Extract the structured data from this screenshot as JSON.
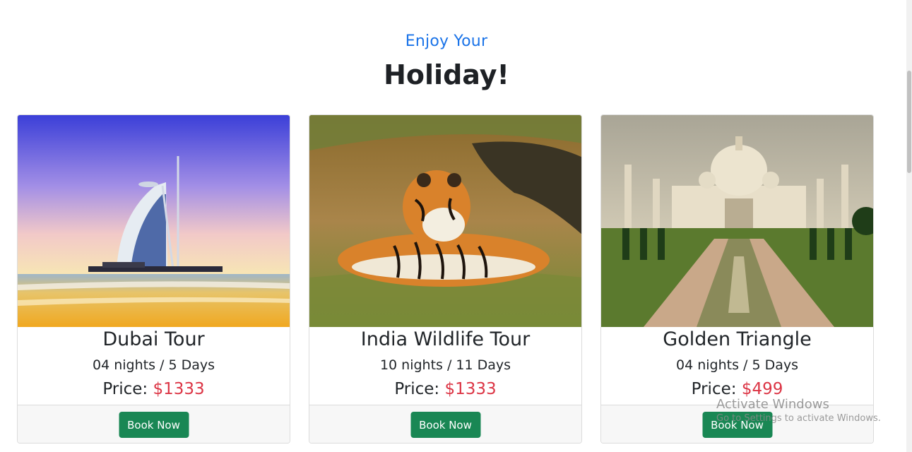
{
  "header": {
    "subtitle": "Enjoy Your",
    "title": "Holiday!"
  },
  "tours": [
    {
      "title": "Dubai Tour",
      "duration": "04 nights / 5 Days",
      "price_label": "Price:",
      "price": "$1333",
      "button": "Book Now",
      "image": "burj-al-arab-beach-sunset"
    },
    {
      "title": "India Wildlife Tour",
      "duration": "10 nights / 11 Days",
      "price_label": "Price:",
      "price": "$1333",
      "button": "Book Now",
      "image": "tiger-resting-in-grass"
    },
    {
      "title": "Golden Triangle",
      "duration": "04 nights / 5 Days",
      "price_label": "Price:",
      "price": "$499",
      "button": "Book Now",
      "image": "taj-mahal-reflecting-pool"
    }
  ],
  "watermark": {
    "title": "Activate Windows",
    "subtitle": "Go to Settings to activate Windows."
  },
  "colors": {
    "accent": "#1a73e8",
    "price": "#dc3545",
    "button": "#198754"
  }
}
